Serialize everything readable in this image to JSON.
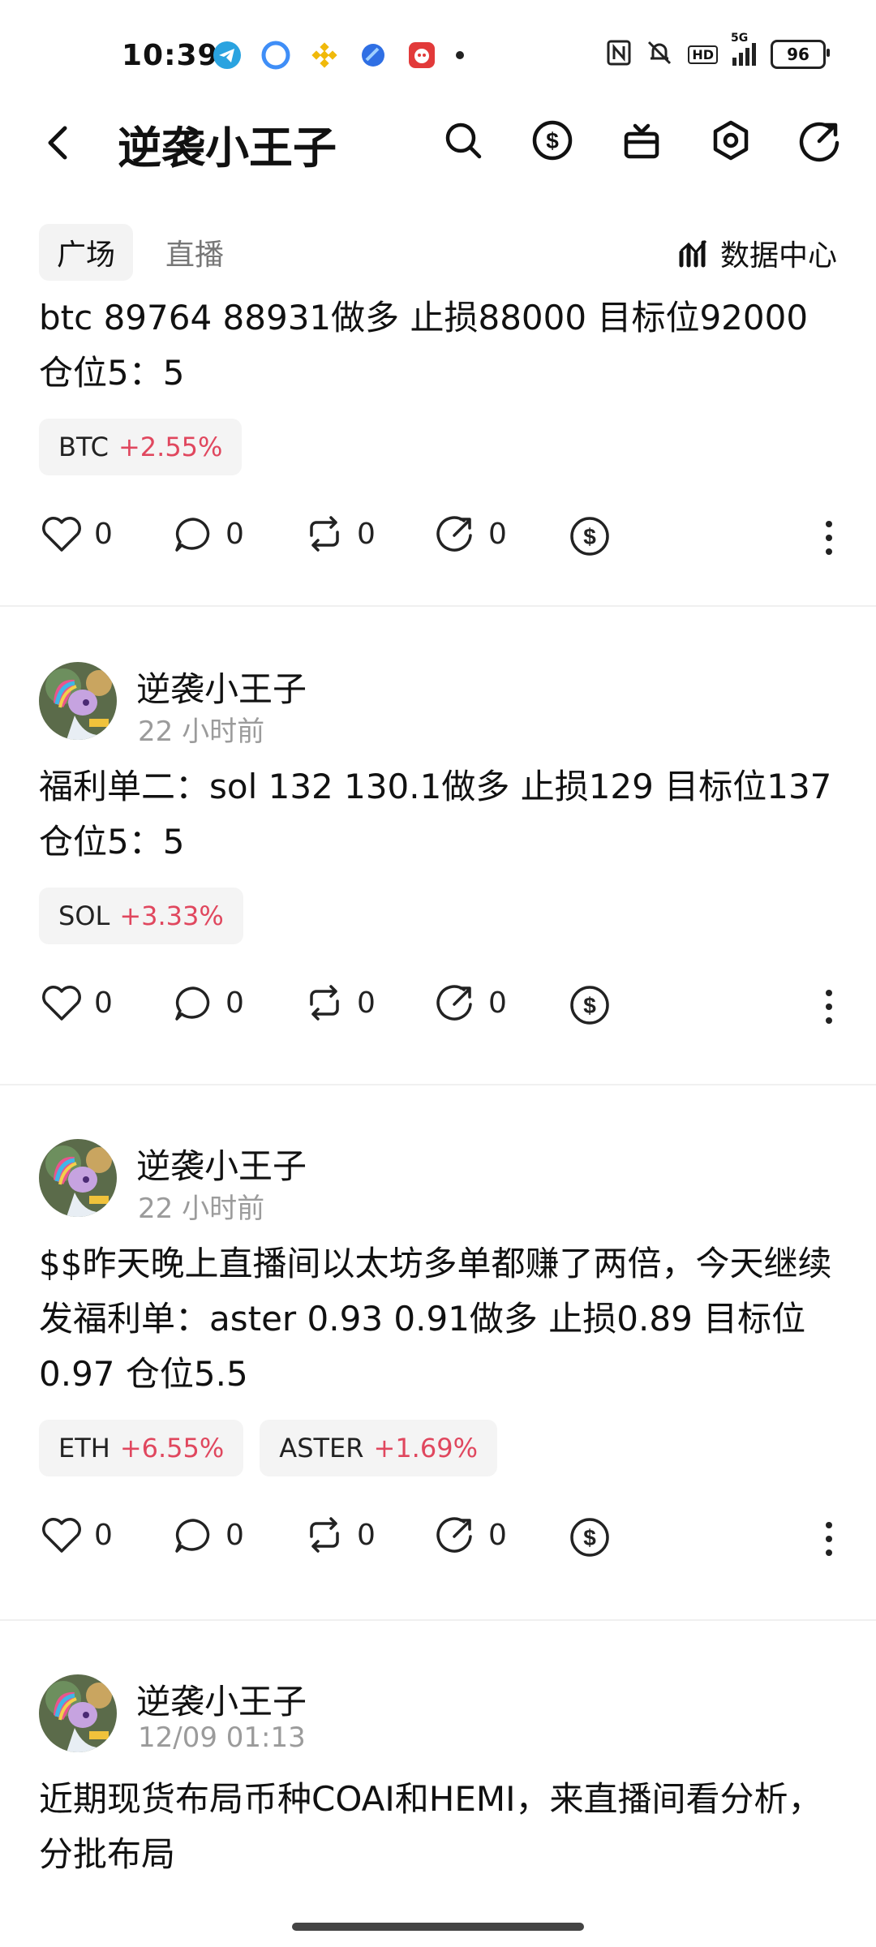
{
  "status_bar": {
    "time": "10:39",
    "battery": "96",
    "network": "5G",
    "hd": "HD"
  },
  "header": {
    "title": "逆袭小王子"
  },
  "tabs": [
    {
      "label": "广场"
    },
    {
      "label": "直播"
    }
  ],
  "data_center": {
    "label": "数据中心"
  },
  "posts": [
    {
      "text": "btc 89764  88931做多 止损88000  目标位92000 仓位5：5",
      "tags": [
        {
          "symbol": "BTC",
          "change": "+2.55%"
        }
      ],
      "likes": "0",
      "comments": "0",
      "reposts": "0",
      "shares": "0"
    },
    {
      "author": "逆袭小王子",
      "time": "22 小时前",
      "text": "福利单二：sol  132  130.1做多 止损129  目标位137 仓位5：5",
      "tags": [
        {
          "symbol": "SOL",
          "change": "+3.33%"
        }
      ],
      "likes": "0",
      "comments": "0",
      "reposts": "0",
      "shares": "0"
    },
    {
      "author": "逆袭小王子",
      "time": "22 小时前",
      "text": "$$昨天晚上直播间以太坊多单都赚了两倍，今天继续发福利单：aster  0.93  0.91做多 止损0.89 目标位0.97 仓位5.5",
      "tags": [
        {
          "symbol": "ETH",
          "change": "+6.55%"
        },
        {
          "symbol": "ASTER",
          "change": "+1.69%"
        }
      ],
      "likes": "0",
      "comments": "0",
      "reposts": "0",
      "shares": "0"
    },
    {
      "author": "逆袭小王子",
      "time": "12/09 01:13",
      "text": "近期现货布局币种COAI和HEMI，来直播间看分析，分批布局"
    }
  ],
  "colors": {
    "positive_change": "#e0475e",
    "muted_text": "#9b9b9b"
  }
}
